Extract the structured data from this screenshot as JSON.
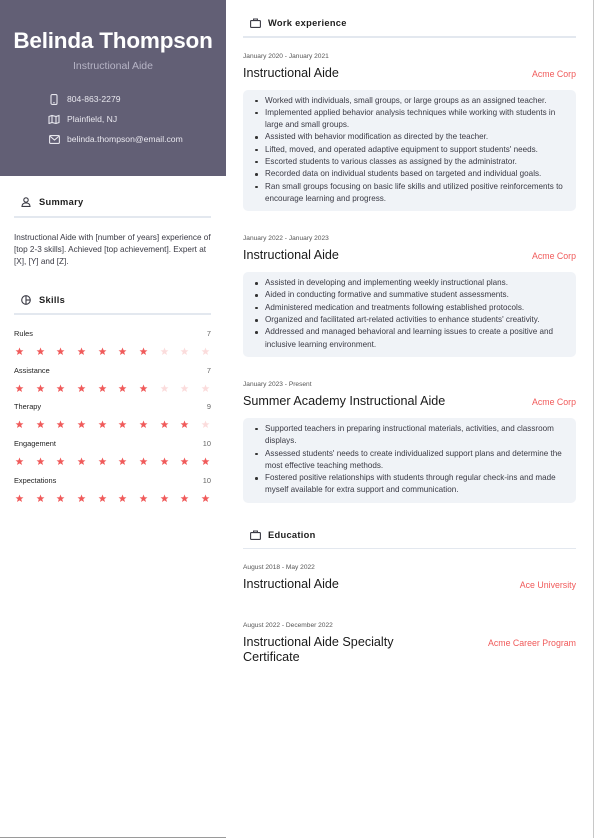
{
  "profile": {
    "name": "Belinda Thompson",
    "role": "Instructional Aide",
    "contacts": [
      {
        "icon": "phone-icon",
        "text": "804-863-2279"
      },
      {
        "icon": "map-icon",
        "text": "Plainfield, NJ"
      },
      {
        "icon": "mail-icon",
        "text": "belinda.thompson@email.com"
      }
    ]
  },
  "summary": {
    "heading": "Summary",
    "icon": "user-icon",
    "text": "Instructional Aide with [number of years] experience of [top 2-3 skills]. Achieved [top achievement]. Expert at [X], [Y] and [Z]."
  },
  "skills": {
    "heading": "Skills",
    "icon": "pie-chart-icon",
    "max": 10,
    "items": [
      {
        "name": "Rules",
        "level": 7
      },
      {
        "name": "Assistance",
        "level": 7
      },
      {
        "name": "Therapy",
        "level": 9
      },
      {
        "name": "Engagement",
        "level": 10
      },
      {
        "name": "Expectations",
        "level": 10
      }
    ]
  },
  "work": {
    "heading": "Work experience",
    "icon": "briefcase-icon",
    "entries": [
      {
        "date": "January 2020 - January 2021",
        "title": "Instructional Aide",
        "org": "Acme Corp",
        "bullets": [
          "Worked with individuals, small groups, or large groups as an assigned teacher.",
          "Implemented applied behavior analysis techniques while working with students in large and small groups.",
          "Assisted with behavior modification as directed by the teacher.",
          "Lifted, moved, and operated adaptive equipment to support students' needs.",
          "Escorted students to various classes as assigned by the administrator.",
          "Recorded data on individual students based on targeted and individual goals.",
          "Ran small groups focusing on basic life skills and utilized positive reinforcements to encourage learning and progress."
        ]
      },
      {
        "date": "January 2022 - January 2023",
        "title": "Instructional Aide",
        "org": "Acme Corp",
        "bullets": [
          "Assisted in developing and implementing weekly instructional plans.",
          "Aided in conducting formative and summative student assessments.",
          "Administered medication and treatments following established protocols.",
          "Organized and facilitated art-related activities to enhance students' creativity.",
          "Addressed and managed behavioral and learning issues to create a positive and inclusive learning environment."
        ]
      },
      {
        "date": "January 2023 - Present",
        "title": "Summer Academy Instructional Aide",
        "org": "Acme Corp",
        "bullets": [
          "Supported teachers in preparing instructional materials, activities, and classroom displays.",
          "Assessed students' needs to create individualized support plans and determine the most effective teaching methods.",
          "Fostered positive relationships with students through regular check-ins and made myself available for extra support and communication."
        ]
      }
    ]
  },
  "education": {
    "heading": "Education",
    "icon": "briefcase-icon",
    "entries": [
      {
        "date": "August 2018 - May 2022",
        "title": "Instructional Aide",
        "org": "Ace University"
      },
      {
        "date": "August 2022 - December 2022",
        "title": "Instructional Aide Specialty Certificate",
        "org": "Acme Career Program"
      }
    ]
  },
  "colors": {
    "sidebar_bg": "#625f75",
    "accent": "#f05a5a",
    "star_filled": "#f05a5a",
    "star_empty": "#fbdcdc",
    "box_bg": "#f0f3f7"
  }
}
